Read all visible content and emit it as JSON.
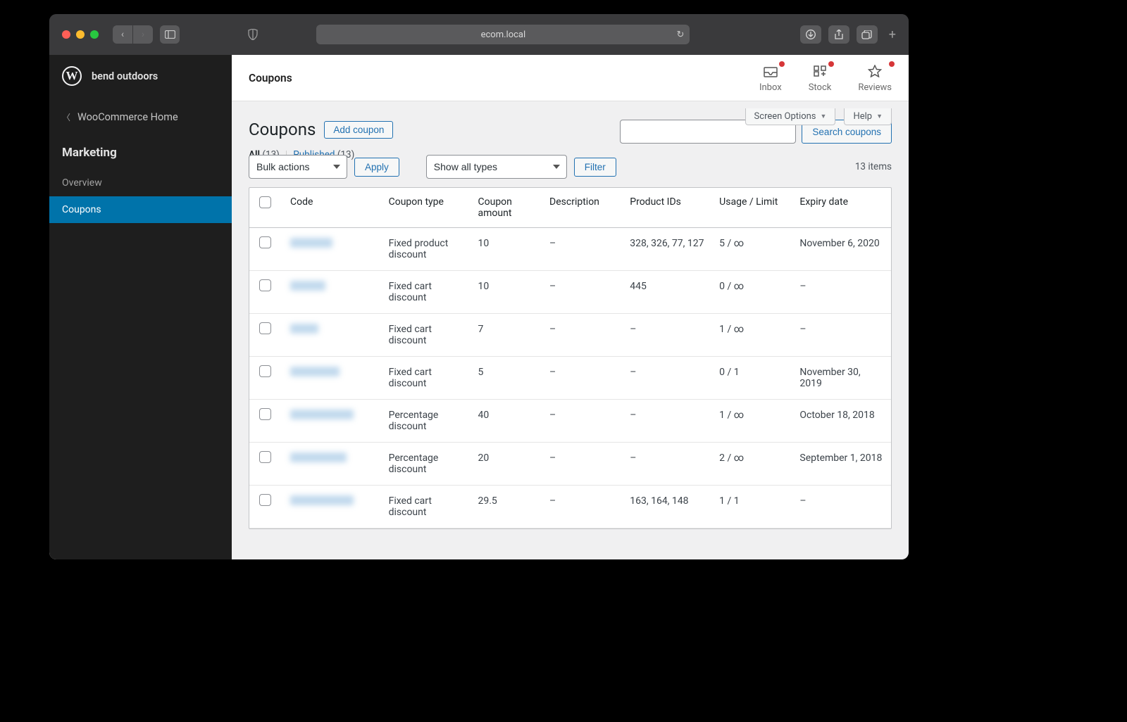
{
  "browser": {
    "url": "ecom.local"
  },
  "site": {
    "name": "bend outdoors"
  },
  "sidebar": {
    "back_label": "WooCommerce Home",
    "group_title": "Marketing",
    "items": [
      {
        "label": "Overview"
      },
      {
        "label": "Coupons"
      }
    ]
  },
  "topbar": {
    "crumb": "Coupons",
    "actions": [
      {
        "label": "Inbox"
      },
      {
        "label": "Stock"
      },
      {
        "label": "Reviews"
      }
    ]
  },
  "tools": {
    "screen_options": "Screen Options",
    "help": "Help"
  },
  "page": {
    "title": "Coupons",
    "add_button": "Add coupon"
  },
  "subsub": {
    "all_label": "All",
    "all_count": "(13)",
    "published_label": "Published",
    "published_count": "(13)"
  },
  "search": {
    "button": "Search coupons"
  },
  "filters": {
    "bulk_actions": "Bulk actions",
    "apply": "Apply",
    "show_all_types": "Show all types",
    "filter": "Filter",
    "items_count": "13 items"
  },
  "table": {
    "headers": {
      "code": "Code",
      "type": "Coupon type",
      "amount": "Coupon amount",
      "description": "Description",
      "product_ids": "Product IDs",
      "usage": "Usage / Limit",
      "expiry": "Expiry date"
    },
    "rows": [
      {
        "type": "Fixed product discount",
        "amount": "10",
        "description": "–",
        "product_ids": "328, 326, 77, 127",
        "usage": "5 / ∞",
        "expiry": "November 6, 2020",
        "code_w": "w60"
      },
      {
        "type": "Fixed cart discount",
        "amount": "10",
        "description": "–",
        "product_ids": "445",
        "usage": "0 / ∞",
        "expiry": "–",
        "code_w": "w50"
      },
      {
        "type": "Fixed cart discount",
        "amount": "7",
        "description": "–",
        "product_ids": "–",
        "usage": "1 / ∞",
        "expiry": "–",
        "code_w": "w40"
      },
      {
        "type": "Fixed cart discount",
        "amount": "5",
        "description": "–",
        "product_ids": "–",
        "usage": "0 / 1",
        "expiry": "November 30, 2019",
        "code_w": "w70"
      },
      {
        "type": "Percentage discount",
        "amount": "40",
        "description": "–",
        "product_ids": "–",
        "usage": "1 / ∞",
        "expiry": "October 18, 2018",
        "code_w": "w90"
      },
      {
        "type": "Percentage discount",
        "amount": "20",
        "description": "–",
        "product_ids": "–",
        "usage": "2 / ∞",
        "expiry": "September 1, 2018",
        "code_w": "w80"
      },
      {
        "type": "Fixed cart discount",
        "amount": "29.5",
        "description": "–",
        "product_ids": "163, 164, 148",
        "usage": "1 / 1",
        "expiry": "–",
        "code_w": "w90"
      }
    ]
  }
}
